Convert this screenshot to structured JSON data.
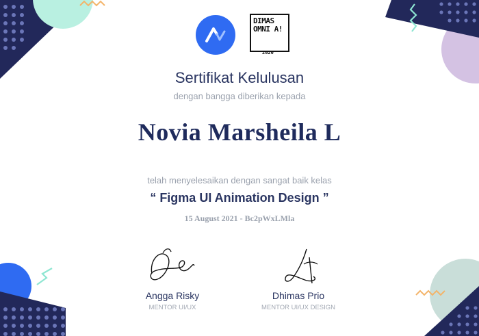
{
  "certificate": {
    "title": "Sertifikat Kelulusan",
    "subtitle": "dengan bangga diberikan kepada",
    "recipient": "Novia Marsheila L",
    "completion_text": "telah menyelesaikan dengan sangat baik kelas",
    "course": "“ Figma UI Animation Design ”",
    "date_code": "15 August 2021 - Bc2pWxLMla"
  },
  "logos": {
    "brand_icon": "arrow-wave-icon",
    "partner_text": "DIMAS OMNI A!",
    "partner_year": "2020"
  },
  "signatories": [
    {
      "name": "Angga Risky",
      "role": "MENTOR UI/UX"
    },
    {
      "name": "Dhimas Prio",
      "role": "MENTOR UI/UX DESIGN"
    }
  ],
  "colors": {
    "navy": "#2a3561",
    "dark_navy": "#22285a",
    "blue": "#2f6bf2",
    "mint": "#b9f0e1",
    "lilac": "#d4c2e3",
    "teal_grey": "#c9ded9",
    "orange": "#f3b46a",
    "muted_text": "#9aa1ad"
  }
}
